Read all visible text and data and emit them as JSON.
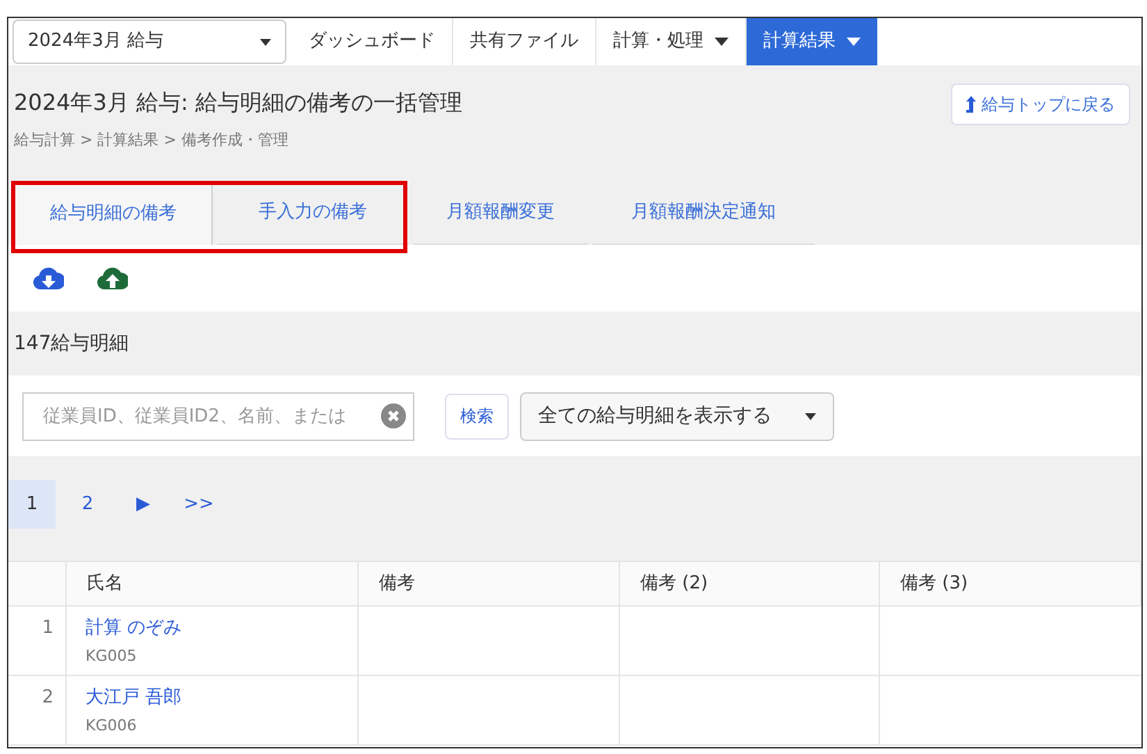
{
  "period_select": {
    "value": "2024年3月 給与"
  },
  "nav": [
    {
      "label": "ダッシュボード",
      "dropdown": false,
      "selected": false
    },
    {
      "label": "共有ファイル",
      "dropdown": false,
      "selected": false
    },
    {
      "label": "計算・処理",
      "dropdown": true,
      "selected": false
    },
    {
      "label": "計算結果",
      "dropdown": true,
      "selected": true
    }
  ],
  "page_title": "2024年3月 給与: 給与明細の備考の一括管理",
  "back_button": "給与トップに戻る",
  "breadcrumb": "給与計算 > 計算結果 > 備考作成・管理",
  "tabs": [
    {
      "label": "給与明細の備考",
      "selected": true
    },
    {
      "label": "手入力の備考",
      "selected": false
    },
    {
      "label": "月額報酬変更",
      "selected": false
    },
    {
      "label": "月額報酬決定通知",
      "selected": false
    }
  ],
  "annotation": {
    "kind": "highlight_box"
  },
  "count_label": "147給与明細",
  "search": {
    "placeholder": "従業員ID、従業員ID2、名前、または",
    "button": "検索"
  },
  "filter_select": {
    "value": "全ての給与明細を表示する"
  },
  "pagination": [
    {
      "label": "1",
      "selected": true
    },
    {
      "label": "2",
      "selected": false
    },
    {
      "label": "▶",
      "selected": false
    },
    {
      "label": ">>",
      "selected": false
    }
  ],
  "table": {
    "columns": [
      "氏名",
      "備考",
      "備考 (2)",
      "備考 (3)"
    ],
    "rows": [
      {
        "number": "1",
        "name": "計算 のぞみ",
        "code": "KG005"
      },
      {
        "number": "2",
        "name": "大江戸 吾郎",
        "code": "KG006"
      }
    ]
  }
}
